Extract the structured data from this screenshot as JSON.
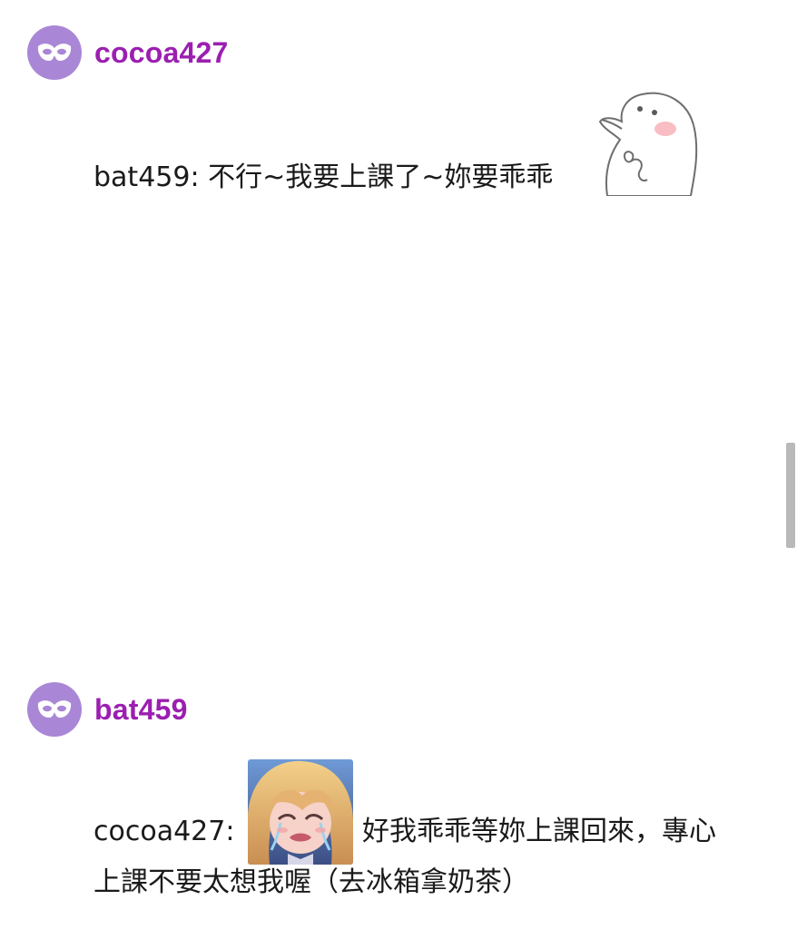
{
  "posts": [
    {
      "author": "cocoa427",
      "avatar_icon": "mask-icon",
      "message_text": "bat459: 不行~我要上課了~妳要乖乖",
      "sticker": "ghost-blush-sticker"
    },
    {
      "author": "bat459",
      "avatar_icon": "mask-icon",
      "message_prefix": "cocoa427: ",
      "sticker": "crying-girl-sticker",
      "message_after_sticker": "好我乖乖等妳上課回來，專心",
      "message_line2": "上課不要太想我喔（去冰箱拿奶茶）"
    }
  ],
  "colors": {
    "username": "#9b1fb0",
    "avatar_bg": "#a987d6",
    "scrollbar": "#b9b9b9"
  }
}
